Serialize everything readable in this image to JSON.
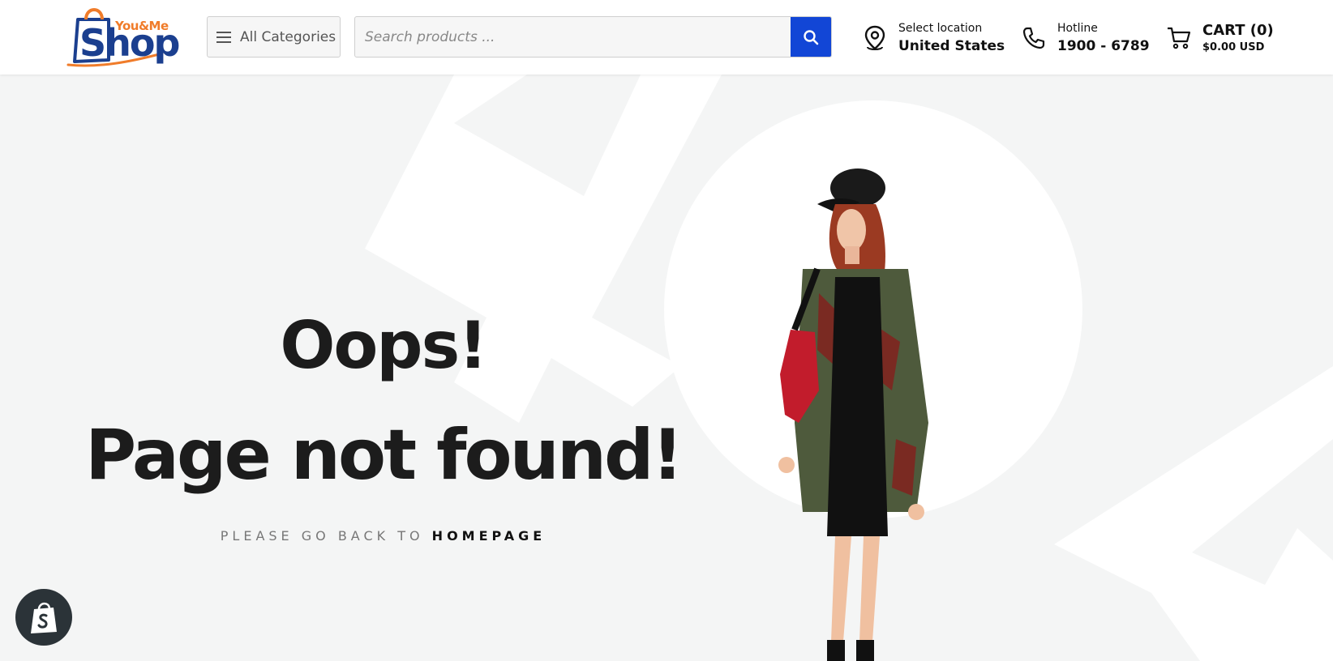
{
  "header": {
    "logo": {
      "top_text": "You&Me",
      "main_text": "Shop"
    },
    "categories_label": "All Categories",
    "search": {
      "placeholder": "Search products ...",
      "value": ""
    },
    "location": {
      "label": "Select location",
      "value": "United States"
    },
    "hotline": {
      "label": "Hotline",
      "value": "1900 - 6789"
    },
    "cart": {
      "title": "CART (0)",
      "total": "$0.00 USD"
    }
  },
  "main": {
    "headline_line1": "Oops!",
    "headline_line2": "Page not found!",
    "back_prefix": "PLEASE GO BACK TO",
    "back_link": "HOMEPAGE"
  },
  "colors": {
    "accent": "#1246d6",
    "logo_blue": "#1b3f8f",
    "logo_orange": "#f07c2a",
    "text_dark": "#1c1c1c",
    "background": "#f4f5f5"
  },
  "icons": {
    "menu": "hamburger-icon",
    "search": "search-icon",
    "location": "location-pin-icon",
    "hotline": "phone-icon",
    "cart": "cart-icon",
    "shopify": "shopify-bag-icon"
  }
}
